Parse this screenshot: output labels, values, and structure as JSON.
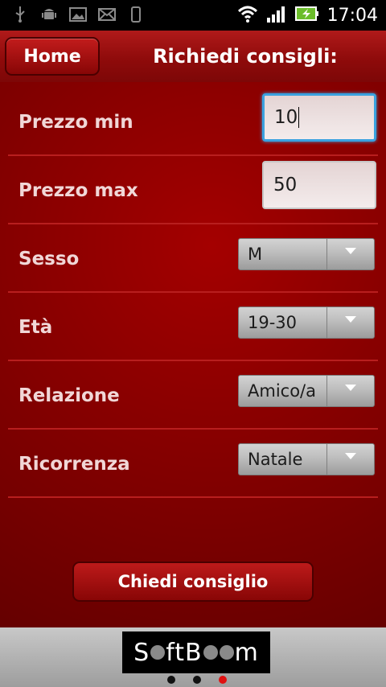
{
  "status_bar": {
    "time": "17:04",
    "left_icons": [
      "usb-icon",
      "android-icon",
      "image-icon",
      "mail-icon",
      "phone-icon"
    ],
    "right_icons": [
      "wifi-icon",
      "signal-icon",
      "battery-icon"
    ]
  },
  "header": {
    "home_label": "Home",
    "title": "Richiedi consigli:"
  },
  "form": {
    "prezzo_min": {
      "label": "Prezzo min",
      "value": "10"
    },
    "prezzo_max": {
      "label": "Prezzo max",
      "value": "50"
    },
    "sesso": {
      "label": "Sesso",
      "selected": "M"
    },
    "eta": {
      "label": "Età",
      "selected": "19-30"
    },
    "relazione": {
      "label": "Relazione",
      "selected": "Amico/a"
    },
    "ricorrenza": {
      "label": "Ricorrenza",
      "selected": "Natale"
    }
  },
  "actions": {
    "submit_label": "Chiedi consiglio"
  },
  "footer": {
    "brand_parts": [
      "S",
      "ftB",
      "",
      "m"
    ],
    "pager": {
      "count": 3,
      "active": 3
    }
  },
  "colors": {
    "accent": "#8a0000",
    "focus": "#3aa2e0",
    "pager_active": "#e01010"
  }
}
